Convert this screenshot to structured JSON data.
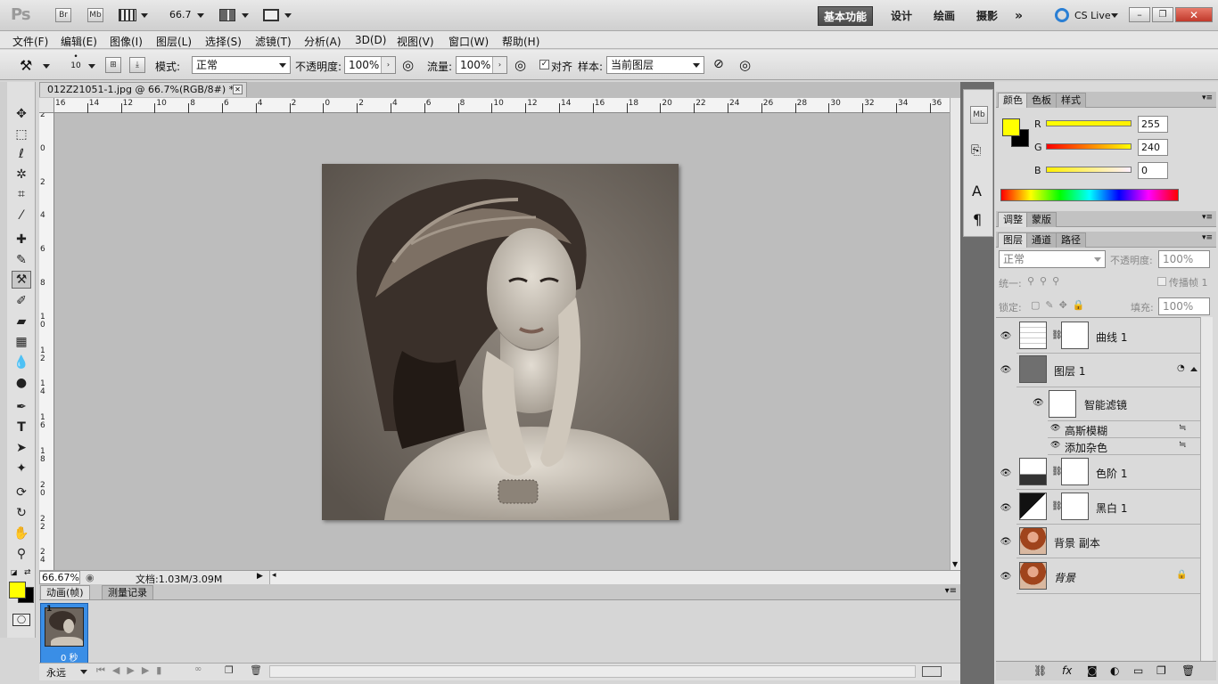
{
  "appbar": {
    "logo": "Ps",
    "br": "Br",
    "mb": "Mb",
    "zoom": "66.7",
    "workspaces": [
      {
        "label": "基本功能",
        "active": true
      },
      {
        "label": "设计",
        "active": false
      },
      {
        "label": "绘画",
        "active": false
      },
      {
        "label": "摄影",
        "active": false
      }
    ],
    "more": "»",
    "cslive": "CS Live"
  },
  "menu": [
    "文件(F)",
    "编辑(E)",
    "图像(I)",
    "图层(L)",
    "选择(S)",
    "滤镜(T)",
    "分析(A)",
    "3D(D)",
    "视图(V)",
    "窗口(W)",
    "帮助(H)"
  ],
  "options": {
    "brush_size": "10",
    "mode_label": "模式:",
    "mode_value": "正常",
    "opacity_label": "不透明度:",
    "opacity_value": "100%",
    "flow_label": "流量:",
    "flow_value": "100%",
    "align_label": "对齐",
    "sample_label": "样本:",
    "sample_value": "当前图层"
  },
  "document": {
    "tab_title": "012Z21051-1.jpg @ 66.7%(RGB/8#) *",
    "zoom": "66.67%",
    "doc_info": "文档:1.03M/3.09M",
    "ruler_top": [
      "16",
      "14",
      "12",
      "10",
      "8",
      "6",
      "4",
      "2",
      "0",
      "2",
      "4",
      "6",
      "8",
      "10",
      "12",
      "14",
      "16",
      "18",
      "20",
      "22",
      "24",
      "26",
      "28",
      "30",
      "32",
      "34",
      "36"
    ],
    "ruler_left": [
      "2",
      "0",
      "2",
      "4",
      "6",
      "8",
      "10",
      "12",
      "14",
      "16",
      "18",
      "20",
      "22",
      "24"
    ]
  },
  "animation": {
    "tabs": [
      "动画(帧)",
      "测量记录"
    ],
    "frame_number": "1",
    "frame_time": "0 秒",
    "loop": "永远"
  },
  "color_panel": {
    "tabs": [
      "颜色",
      "色板",
      "样式"
    ],
    "r_label": "R",
    "g_label": "G",
    "b_label": "B",
    "r": "255",
    "g": "240",
    "b": "0",
    "fg": "#ffff00",
    "bg": "#000000"
  },
  "adjust_panel": {
    "tabs": [
      "调整",
      "蒙版"
    ]
  },
  "layers_panel": {
    "tabs": [
      "图层",
      "通道",
      "路径"
    ],
    "blend": "正常",
    "opacity_label": "不透明度:",
    "opacity": "100%",
    "unify_label": "统一:",
    "propagate_label": "传播帧 1",
    "lock_label": "锁定:",
    "fill_label": "填充:",
    "fill": "100%",
    "layers": [
      {
        "name": "曲线 1",
        "type": "curves"
      },
      {
        "name": "图层 1",
        "type": "smart"
      },
      {
        "name": "智能滤镜",
        "type": "filtermask"
      },
      {
        "name": "高斯模糊",
        "type": "filter"
      },
      {
        "name": "添加杂色",
        "type": "filter"
      },
      {
        "name": "色阶 1",
        "type": "levels"
      },
      {
        "name": "黑白 1",
        "type": "bw"
      },
      {
        "name": "背景 副本",
        "type": "photo"
      },
      {
        "name": "背景",
        "type": "background"
      }
    ]
  }
}
